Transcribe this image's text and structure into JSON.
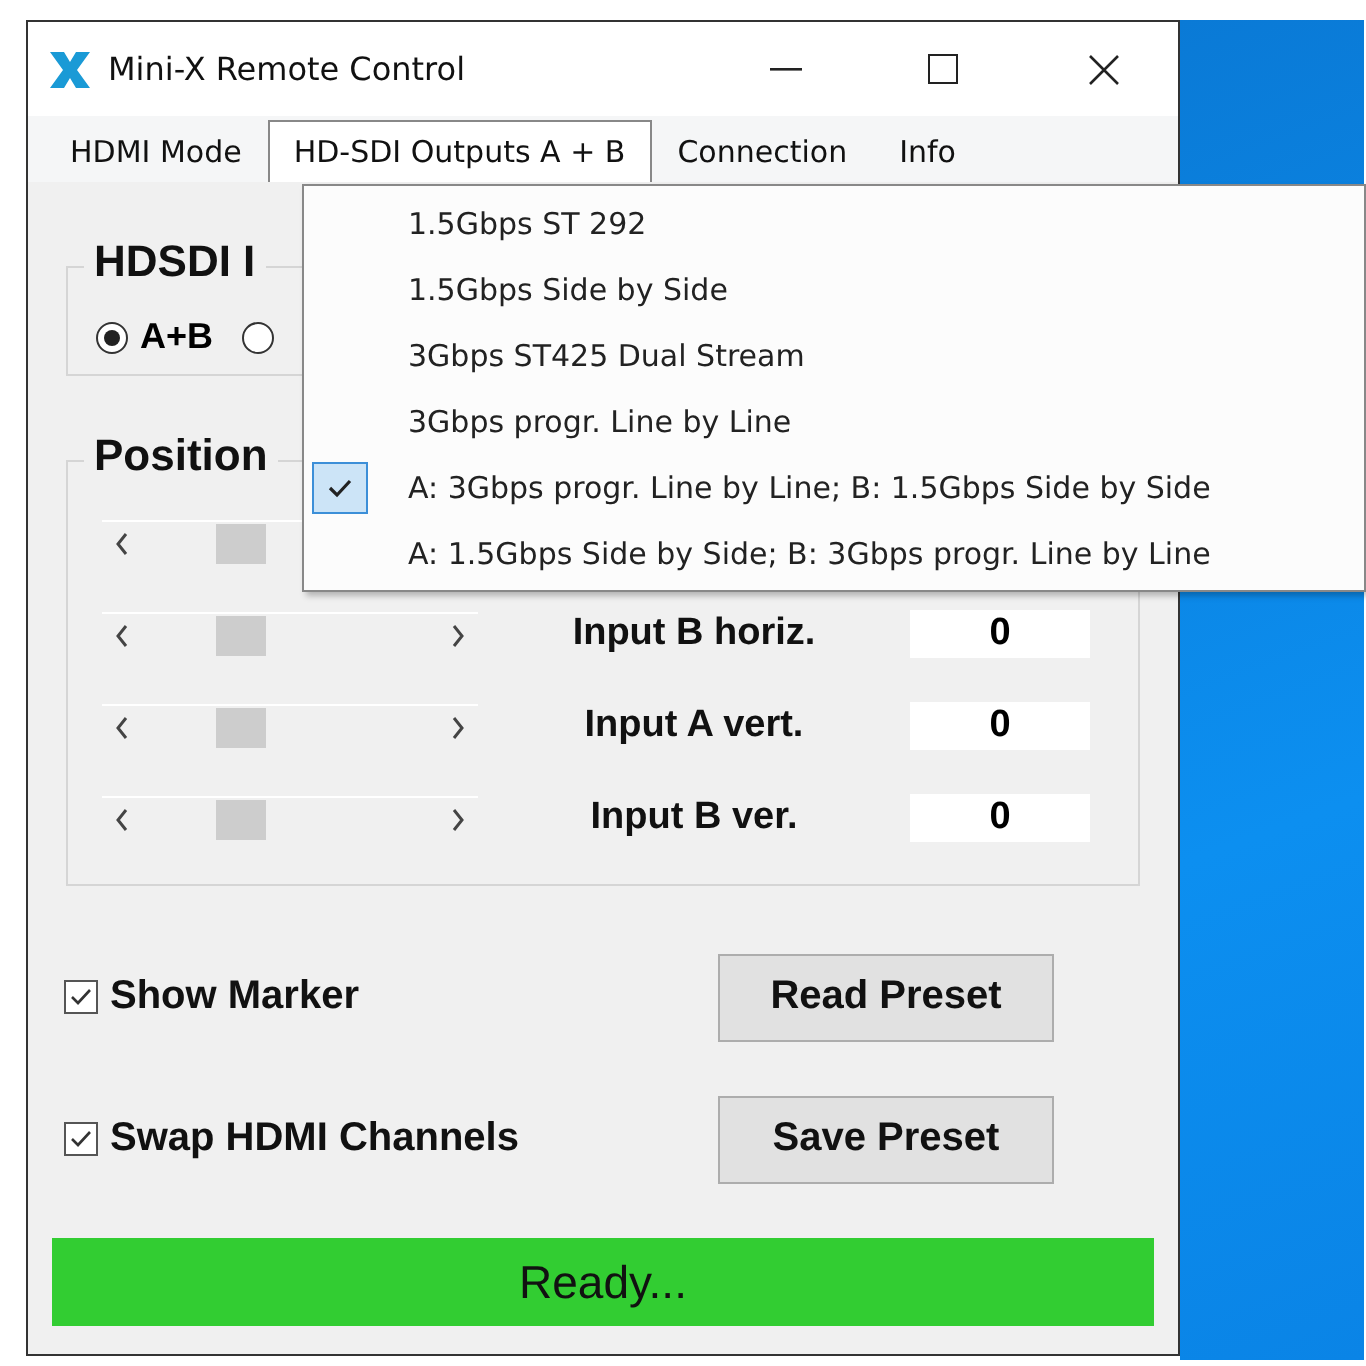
{
  "window": {
    "title": "Mini-X Remote Control"
  },
  "menu_bar": [
    {
      "label": "HDMI Mode",
      "selected": false
    },
    {
      "label": "HD-SDI Outputs A + B",
      "selected": true
    },
    {
      "label": "Connection",
      "selected": false
    },
    {
      "label": "Info",
      "selected": false
    }
  ],
  "dropdown": [
    {
      "label": "1.5Gbps ST 292",
      "checked": false
    },
    {
      "label": "1.5Gbps Side by Side",
      "checked": false
    },
    {
      "label": "3Gbps ST425 Dual Stream",
      "checked": false
    },
    {
      "label": "3Gbps progr. Line by Line",
      "checked": false
    },
    {
      "label": "A: 3Gbps progr. Line by Line; B: 1.5Gbps Side by Side",
      "checked": true
    },
    {
      "label": "A: 1.5Gbps Side by Side; B: 3Gbps progr. Line by Line",
      "checked": false
    }
  ],
  "input_group": {
    "title": "HDSDI I",
    "radios": [
      {
        "label": "A+B",
        "selected": true
      },
      {
        "selected": false
      }
    ]
  },
  "position_group": {
    "title": "Position",
    "rows": [
      {
        "kind": "covered"
      },
      {
        "kind": "full",
        "label": "Input B horiz.",
        "value": "0"
      },
      {
        "kind": "full",
        "label": "Input A vert.",
        "value": "0"
      },
      {
        "kind": "full",
        "label": "Input B ver.",
        "value": "0"
      }
    ]
  },
  "options": [
    {
      "label": "Show Marker",
      "checked": true,
      "button": "Read Preset"
    },
    {
      "label": "Swap HDMI Channels",
      "checked": true,
      "button": "Save Preset"
    }
  ],
  "status_bar": {
    "text": "Ready..."
  }
}
